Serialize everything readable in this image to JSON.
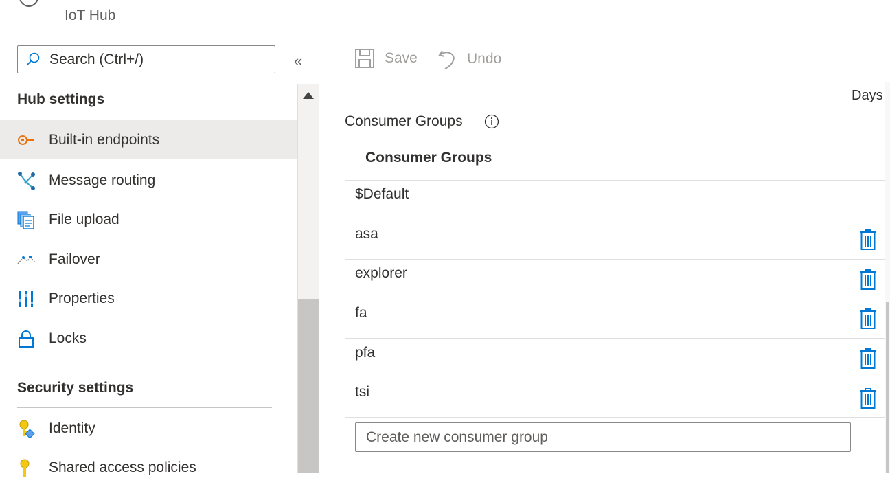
{
  "header": {
    "subtitle": "IoT Hub"
  },
  "search": {
    "placeholder": "Search (Ctrl+/)"
  },
  "collapse_icon": "«",
  "sidebar": {
    "sections": [
      {
        "title": "Hub settings",
        "items": [
          {
            "label": "Built-in endpoints",
            "icon": "endpoint-icon",
            "active": true
          },
          {
            "label": "Message routing",
            "icon": "routing-icon"
          },
          {
            "label": "File upload",
            "icon": "file-upload-icon"
          },
          {
            "label": "Failover",
            "icon": "failover-icon"
          },
          {
            "label": "Properties",
            "icon": "properties-icon"
          },
          {
            "label": "Locks",
            "icon": "lock-icon"
          }
        ]
      },
      {
        "title": "Security settings",
        "items": [
          {
            "label": "Identity",
            "icon": "identity-icon"
          },
          {
            "label": "Shared access policies",
            "icon": "key-icon"
          }
        ]
      }
    ]
  },
  "toolbar": {
    "save_label": "Save",
    "undo_label": "Undo"
  },
  "content": {
    "days_label": "Days",
    "consumer_groups_label": "Consumer Groups",
    "table_header": "Consumer Groups",
    "rows": [
      "$Default",
      "asa",
      "explorer",
      "fa",
      "pfa",
      "tsi"
    ],
    "new_placeholder": "Create new consumer group"
  },
  "colors": {
    "accent": "#0078d4",
    "active_bg": "#edebe9",
    "disabled_text": "#a19f9d"
  }
}
